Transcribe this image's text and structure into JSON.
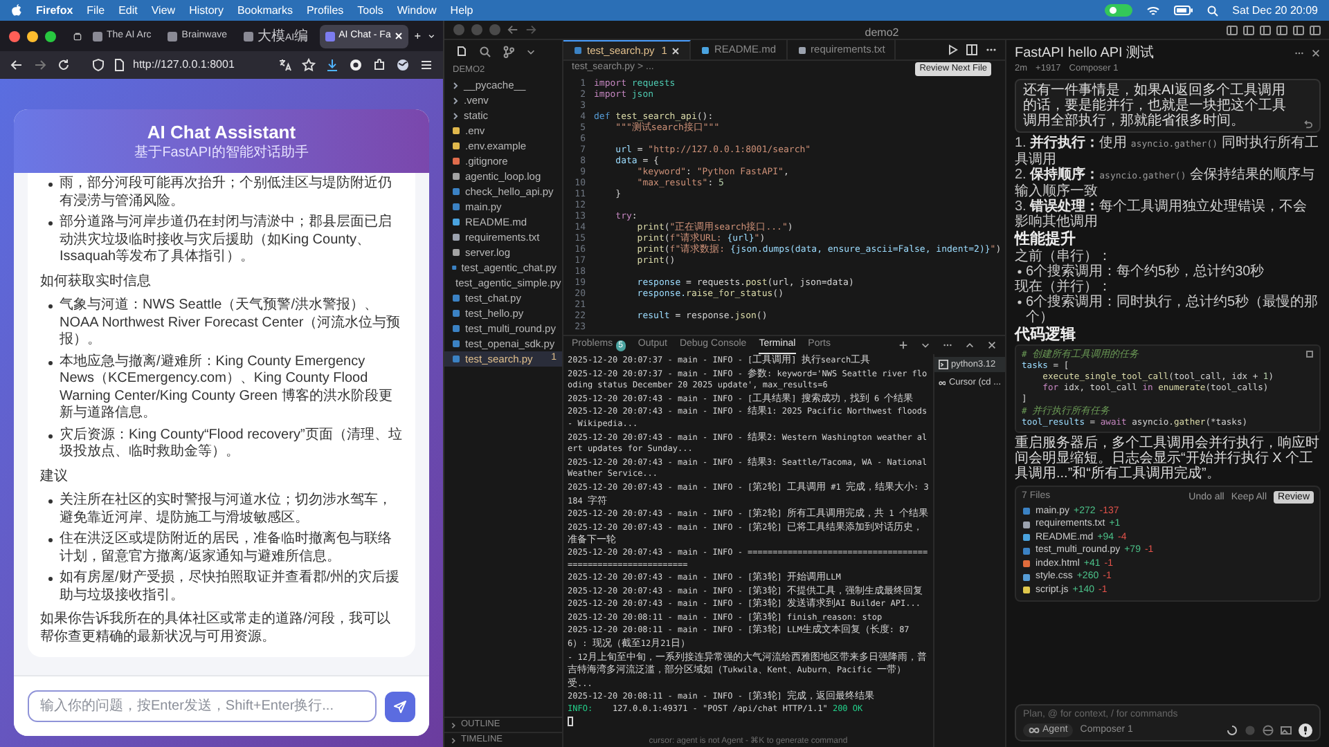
{
  "menu_bar": {
    "app": "Firefox",
    "items": [
      "File",
      "Edit",
      "View",
      "History",
      "Bookmarks",
      "Profiles",
      "Tools",
      "Window",
      "Help"
    ],
    "clock": "Sat Dec 20 20:09"
  },
  "browser": {
    "tabs": [
      {
        "label": "The AI Arc",
        "selected": false
      },
      {
        "label": "Brainwave",
        "selected": false
      },
      {
        "label": "大模AI编",
        "selected": false
      },
      {
        "label": "AI Chat - Fa",
        "selected": true
      }
    ],
    "url": "http://127.0.0.1:8001"
  },
  "chat": {
    "title": "AI Chat Assistant",
    "subtitle": "基于FastAPI的智能对话助手",
    "message": [
      {
        "kind": "list",
        "items": [
          "雨，部分河段可能再次抬升；个别低洼区与堤防附近仍有浸涝与管涌风险。",
          "部分道路与河岸步道仍在封闭与清淤中；郡县层面已启动洪灾垃圾临时接收与灾后援助（如King County、Issaquah等发布了具体指引）。"
        ]
      },
      {
        "kind": "para",
        "text": "如何获取实时信息"
      },
      {
        "kind": "list",
        "items": [
          "气象与河道：NWS Seattle（天气预警/洪水警报）、NOAA Northwest River Forecast Center（河流水位与预报）。",
          "本地应急与撤离/避难所：King County Emergency News（KCEmergency.com）、King County Flood Warning Center/King County Green 博客的洪水阶段更新与道路信息。",
          "灾后资源：King County“Flood recovery”页面（清理、垃圾投放点、临时救助金等）。"
        ]
      },
      {
        "kind": "para",
        "text": "建议"
      },
      {
        "kind": "list",
        "items": [
          "关注所在社区的实时警报与河道水位；切勿涉水驾车，避免靠近河岸、堤防施工与滑坡敏感区。",
          "住在洪泛区或堤防附近的居民，准备临时撤离包与联络计划，留意官方撤离/返家通知与避难所信息。",
          "如有房屋/财产受损，尽快拍照取证并查看郡/州的灾后援助与垃圾接收指引。"
        ]
      },
      {
        "kind": "para",
        "text": "如果你告诉我所在的具体社区或常走的道路/河段，我可以帮你查更精确的最新状况与可用资源。"
      }
    ],
    "input_placeholder": "输入你的问题，按Enter发送，Shift+Enter换行..."
  },
  "editor": {
    "window_title": "demo2",
    "explorer": {
      "section": "DEMO2",
      "items": [
        {
          "name": "__pycache__",
          "kind": "folder",
          "selected": false
        },
        {
          "name": ".venv",
          "kind": "folder",
          "selected": false
        },
        {
          "name": "static",
          "kind": "folder",
          "selected": false
        },
        {
          "name": ".env",
          "kind": "env",
          "selected": false
        },
        {
          "name": ".env.example",
          "kind": "env",
          "selected": false
        },
        {
          "name": ".gitignore",
          "kind": "git",
          "selected": false
        },
        {
          "name": "agentic_loop.log",
          "kind": "log",
          "selected": false
        },
        {
          "name": "check_hello_api.py",
          "kind": "py",
          "selected": false
        },
        {
          "name": "main.py",
          "kind": "py",
          "selected": false
        },
        {
          "name": "README.md",
          "kind": "md",
          "selected": false
        },
        {
          "name": "requirements.txt",
          "kind": "txt",
          "selected": false
        },
        {
          "name": "server.log",
          "kind": "log",
          "selected": false
        },
        {
          "name": "test_agentic_chat.py",
          "kind": "py",
          "selected": false
        },
        {
          "name": "test_agentic_simple.py",
          "kind": "py",
          "selected": false
        },
        {
          "name": "test_chat.py",
          "kind": "py",
          "selected": false
        },
        {
          "name": "test_hello.py",
          "kind": "py",
          "selected": false
        },
        {
          "name": "test_multi_round.py",
          "kind": "py",
          "selected": false
        },
        {
          "name": "test_openai_sdk.py",
          "kind": "py",
          "selected": false
        },
        {
          "name": "test_search.py",
          "kind": "py",
          "selected": true,
          "badge": "1"
        }
      ],
      "bottom_sections": [
        "OUTLINE",
        "TIMELINE"
      ]
    },
    "tabs": [
      {
        "label": "test_search.py",
        "kind": "py",
        "badge": "1",
        "selected": true
      },
      {
        "label": "README.md",
        "kind": "md",
        "selected": false
      },
      {
        "label": "requirements.txt",
        "kind": "txt",
        "selected": false
      }
    ],
    "breadcrumb": "test_search.py > ...",
    "review_button": "Review Next File",
    "code": [
      {
        "n": "1",
        "tokens": [
          {
            "text": "import",
            "kind": "keyword"
          },
          {
            "text": " requests",
            "kind": "type"
          }
        ]
      },
      {
        "n": "2",
        "tokens": [
          {
            "text": "import",
            "kind": "keyword"
          },
          {
            "text": " json",
            "kind": "type"
          }
        ]
      },
      {
        "n": "3"
      },
      {
        "n": "4",
        "tokens": [
          {
            "text": "def",
            "kind": "builtin"
          },
          {
            "text": " test_search_api",
            "kind": "func"
          },
          {
            "text": "():",
            "kind": "plain"
          }
        ]
      },
      {
        "n": "5",
        "tokens": [
          {
            "text": "    \"\"\"测试search接口\"\"\"",
            "kind": "string"
          }
        ]
      },
      {
        "n": "6"
      },
      {
        "n": "7",
        "tokens": [
          {
            "text": "    url",
            "kind": "var"
          },
          {
            "text": " = ",
            "kind": "plain"
          },
          {
            "text": "\"http://127.0.0.1:8001/search\"",
            "kind": "string"
          }
        ]
      },
      {
        "n": "8",
        "tokens": [
          {
            "text": "    data",
            "kind": "var"
          },
          {
            "text": " = {",
            "kind": "plain"
          }
        ]
      },
      {
        "n": "9",
        "tokens": [
          {
            "text": "        \"keyword\"",
            "kind": "string"
          },
          {
            "text": ": ",
            "kind": "plain"
          },
          {
            "text": "\"Python FastAPI\"",
            "kind": "string"
          },
          {
            "text": ",",
            "kind": "plain"
          }
        ]
      },
      {
        "n": "10",
        "tokens": [
          {
            "text": "        \"max_results\"",
            "kind": "string"
          },
          {
            "text": ": ",
            "kind": "plain"
          },
          {
            "text": "5",
            "kind": "number"
          }
        ]
      },
      {
        "n": "11",
        "tokens": [
          {
            "text": "    }",
            "kind": "plain"
          }
        ]
      },
      {
        "n": "12"
      },
      {
        "n": "13",
        "tokens": [
          {
            "text": "    try",
            "kind": "keyword"
          },
          {
            "text": ":",
            "kind": "plain"
          }
        ]
      },
      {
        "n": "14",
        "tokens": [
          {
            "text": "        print",
            "kind": "func"
          },
          {
            "text": "(",
            "kind": "plain"
          },
          {
            "text": "\"正在调用search接口...\"",
            "kind": "string"
          },
          {
            "text": ")",
            "kind": "plain"
          }
        ]
      },
      {
        "n": "15",
        "tokens": [
          {
            "text": "        print",
            "kind": "func"
          },
          {
            "text": "(",
            "kind": "plain"
          },
          {
            "text": "f\"请求URL: ",
            "kind": "string"
          },
          {
            "text": "{url}",
            "kind": "var"
          },
          {
            "text": "\"",
            "kind": "string"
          },
          {
            "text": ")",
            "kind": "plain"
          }
        ]
      },
      {
        "n": "16",
        "tokens": [
          {
            "text": "        print",
            "kind": "func"
          },
          {
            "text": "(",
            "kind": "plain"
          },
          {
            "text": "f\"请求数据: ",
            "kind": "string"
          },
          {
            "text": "{json.dumps(data, ensure_ascii=False, indent=2)}",
            "kind": "var"
          },
          {
            "text": "\"",
            "kind": "string"
          },
          {
            "text": ")",
            "kind": "plain"
          }
        ]
      },
      {
        "n": "17",
        "tokens": [
          {
            "text": "        print",
            "kind": "func"
          },
          {
            "text": "()",
            "kind": "plain"
          }
        ]
      },
      {
        "n": "18"
      },
      {
        "n": "19",
        "tokens": [
          {
            "text": "        response",
            "kind": "var"
          },
          {
            "text": " = requests.",
            "kind": "plain"
          },
          {
            "text": "post",
            "kind": "func"
          },
          {
            "text": "(url, json=data)",
            "kind": "plain"
          }
        ]
      },
      {
        "n": "20",
        "tokens": [
          {
            "text": "        response.",
            "kind": "var"
          },
          {
            "text": "raise_for_status",
            "kind": "func"
          },
          {
            "text": "()",
            "kind": "plain"
          }
        ]
      },
      {
        "n": "21"
      },
      {
        "n": "22",
        "tokens": [
          {
            "text": "        result",
            "kind": "var"
          },
          {
            "text": " = response.",
            "kind": "plain"
          },
          {
            "text": "json",
            "kind": "func"
          },
          {
            "text": "()",
            "kind": "plain"
          }
        ]
      },
      {
        "n": "23"
      }
    ],
    "panel": {
      "tabs": [
        {
          "label": "Problems",
          "badge": "5",
          "selected": false
        },
        {
          "label": "Output",
          "selected": false
        },
        {
          "label": "Debug Console",
          "selected": false
        },
        {
          "label": "Terminal",
          "selected": true
        },
        {
          "label": "Ports",
          "selected": false
        }
      ],
      "terminal_lines": [
        {
          "kind": "log",
          "text": "2025-12-20 20:07:37 - main - INFO - [工具调用] 执行search工具"
        },
        {
          "kind": "log",
          "text": "2025-12-20 20:07:37 - main - INFO -   参数: keyword='NWS Seattle river flooding status December 20 2025 update', max_results=6"
        },
        {
          "kind": "log",
          "text": "2025-12-20 20:07:43 - main - INFO - [工具结果] 搜索成功，找到 6 个结果"
        },
        {
          "kind": "log",
          "text": "2025-12-20 20:07:43 - main - INFO -   结果1: 2025 Pacific Northwest floods - Wikipedia..."
        },
        {
          "kind": "log",
          "text": "2025-12-20 20:07:43 - main - INFO -   结果2: Western Washington weather alert updates for Sunday..."
        },
        {
          "kind": "log",
          "text": "2025-12-20 20:07:43 - main - INFO -   结果3: Seattle/Tacoma, WA - National Weather Service..."
        },
        {
          "kind": "log",
          "text": "2025-12-20 20:07:43 - main - INFO - [第2轮] 工具调用 #1 完成，结果大小: 3184 字符"
        },
        {
          "kind": "log",
          "text": "2025-12-20 20:07:43 - main - INFO - [第2轮] 所有工具调用完成，共 1 个结果"
        },
        {
          "kind": "log",
          "text": "2025-12-20 20:07:43 - main - INFO - [第2轮] 已将工具结果添加到对话历史，准备下一轮"
        },
        {
          "kind": "log",
          "text": "2025-12-20 20:07:43 - main - INFO - ============================================================"
        },
        {
          "kind": "log",
          "text": "2025-12-20 20:07:43 - main - INFO - [第3轮] 开始调用LLM"
        },
        {
          "kind": "log",
          "text": "2025-12-20 20:07:43 - main - INFO - [第3轮] 不提供工具，强制生成最终回复"
        },
        {
          "kind": "log",
          "text": "2025-12-20 20:07:43 - main - INFO - [第3轮] 发送请求到AI Builder API..."
        },
        {
          "kind": "log",
          "text": "2025-12-20 20:08:11 - main - INFO - [第3轮] finish_reason: stop"
        },
        {
          "kind": "log",
          "text": "2025-12-20 20:08:11 - main - INFO - [第3轮] LLM生成文本回复（长度: 876）: 现况（截至12月21日）"
        },
        {
          "kind": "log",
          "text": "- 12月上旬至中旬，一系列接连异常强的大气河流给西雅图地区带来多日强降雨，普吉特海湾多河流泛滥，部分区域如（Tukwila、Kent、Auburn、Pacific 一带）受..."
        },
        {
          "kind": "log",
          "text": "2025-12-20 20:08:11 - main - INFO - [第3轮] 完成，返回最终结果"
        },
        {
          "kind": "access",
          "parts": [
            "INFO:",
            "    127.0.0.1:49371 - \"POST /api/chat HTTP/1.1\" ",
            "200 OK"
          ]
        }
      ],
      "terminals": [
        {
          "label": "python3.12",
          "kind": "shell",
          "selected": true
        },
        {
          "label": "Cursor (cd ...",
          "kind": "agent",
          "selected": false
        }
      ],
      "hint": "cursor: agent is not Agent - ⌘K to generate command"
    }
  },
  "agent": {
    "title": "FastAPI hello API 测试",
    "meta": [
      "2m",
      "+1917",
      "Composer 1"
    ],
    "user_message": "还有一件事情是，如果AI返回多个工具调用的话，要是能并行，也就是一块把这个工具调用全部执行，那就能省很多时间。",
    "steps": [
      {
        "num": "1.",
        "parts": [
          {
            "text": "并行执行：",
            "kind": "label"
          },
          {
            "text": "使用 ",
            "kind": "text"
          },
          {
            "text": "asyncio.gather()",
            "kind": "code"
          },
          {
            "text": " 同时执行所有工具调用",
            "kind": "text"
          }
        ]
      },
      {
        "num": "2.",
        "parts": [
          {
            "text": "保持顺序：",
            "kind": "label"
          },
          {
            "text": "asyncio.gather()",
            "kind": "code"
          },
          {
            "text": " 会保持结果的顺序与输入顺序一致",
            "kind": "text"
          }
        ]
      },
      {
        "num": "3.",
        "parts": [
          {
            "text": "错误处理：",
            "kind": "label"
          },
          {
            "text": "每个工具调用独立处理错误，不会影响其他调用",
            "kind": "text"
          }
        ]
      }
    ],
    "sections": [
      {
        "heading": "性能提升",
        "blocks": [
          {
            "kind": "label",
            "text": "之前（串行）："
          },
          {
            "kind": "bullet",
            "text": "6个搜索调用：每个约5秒，总计约30秒"
          },
          {
            "kind": "label",
            "text": "现在（并行）："
          },
          {
            "kind": "bullet",
            "text": "6个搜索调用：同时执行，总计约5秒（最慢的那个）"
          }
        ]
      },
      {
        "heading": "代码逻辑",
        "blocks": [
          {
            "kind": "code",
            "lines": [
              [
                {
                  "text": "# 创建所有工具调用的任务",
                  "kind": "comment"
                }
              ],
              [
                {
                  "text": "tasks",
                  "kind": "var"
                },
                {
                  "text": " = [",
                  "kind": "plain"
                }
              ],
              [
                {
                  "text": "    execute_single_tool_call",
                  "kind": "func"
                },
                {
                  "text": "(tool_call, idx + ",
                  "kind": "plain"
                },
                {
                  "text": "1",
                  "kind": "number"
                },
                {
                  "text": ")",
                  "kind": "plain"
                }
              ],
              [
                {
                  "text": "    for",
                  "kind": "keyword"
                },
                {
                  "text": " idx, tool_call ",
                  "kind": "plain"
                },
                {
                  "text": "in",
                  "kind": "keyword"
                },
                {
                  "text": " enumerate",
                  "kind": "func"
                },
                {
                  "text": "(tool_calls)",
                  "kind": "plain"
                }
              ],
              [
                {
                  "text": "]",
                  "kind": "plain"
                }
              ],
              [
                {
                  "text": "# 并行执行所有任务",
                  "kind": "comment"
                }
              ],
              [
                {
                  "text": "tool_results",
                  "kind": "var"
                },
                {
                  "text": " = ",
                  "kind": "plain"
                },
                {
                  "text": "await",
                  "kind": "keyword"
                },
                {
                  "text": " asyncio.",
                  "kind": "plain"
                },
                {
                  "text": "gather",
                  "kind": "func"
                },
                {
                  "text": "(*tasks)",
                  "kind": "plain"
                }
              ]
            ]
          },
          {
            "kind": "para",
            "text": "重启服务器后，多个工具调用会并行执行，响应时间会明显缩短。日志会显示“开始并行执行 X 个工具调用...”和“所有工具调用完成”。"
          }
        ]
      }
    ],
    "files": {
      "header": "7 Files",
      "actions": [
        {
          "label": "Undo all",
          "kind": "text"
        },
        {
          "label": "Keep All",
          "kind": "text"
        },
        {
          "label": "Review",
          "kind": "primary"
        }
      ],
      "items": [
        {
          "name": "main.py",
          "kind": "py",
          "added": "+272",
          "removed": "-137"
        },
        {
          "name": "requirements.txt",
          "kind": "txt",
          "added": "+1"
        },
        {
          "name": "README.md",
          "kind": "md",
          "added": "+94",
          "removed": "-4"
        },
        {
          "name": "test_multi_round.py",
          "kind": "py",
          "added": "+79",
          "removed": "-1"
        },
        {
          "name": "index.html",
          "kind": "html",
          "added": "+41",
          "removed": "-1"
        },
        {
          "name": "style.css",
          "kind": "css",
          "added": "+260",
          "removed": "-1"
        },
        {
          "name": "script.js",
          "kind": "js",
          "added": "+140",
          "removed": "-1"
        }
      ]
    },
    "input": {
      "placeholder": "Plan, @ for context, / for commands",
      "mode": "Agent",
      "model": "Composer 1"
    }
  }
}
